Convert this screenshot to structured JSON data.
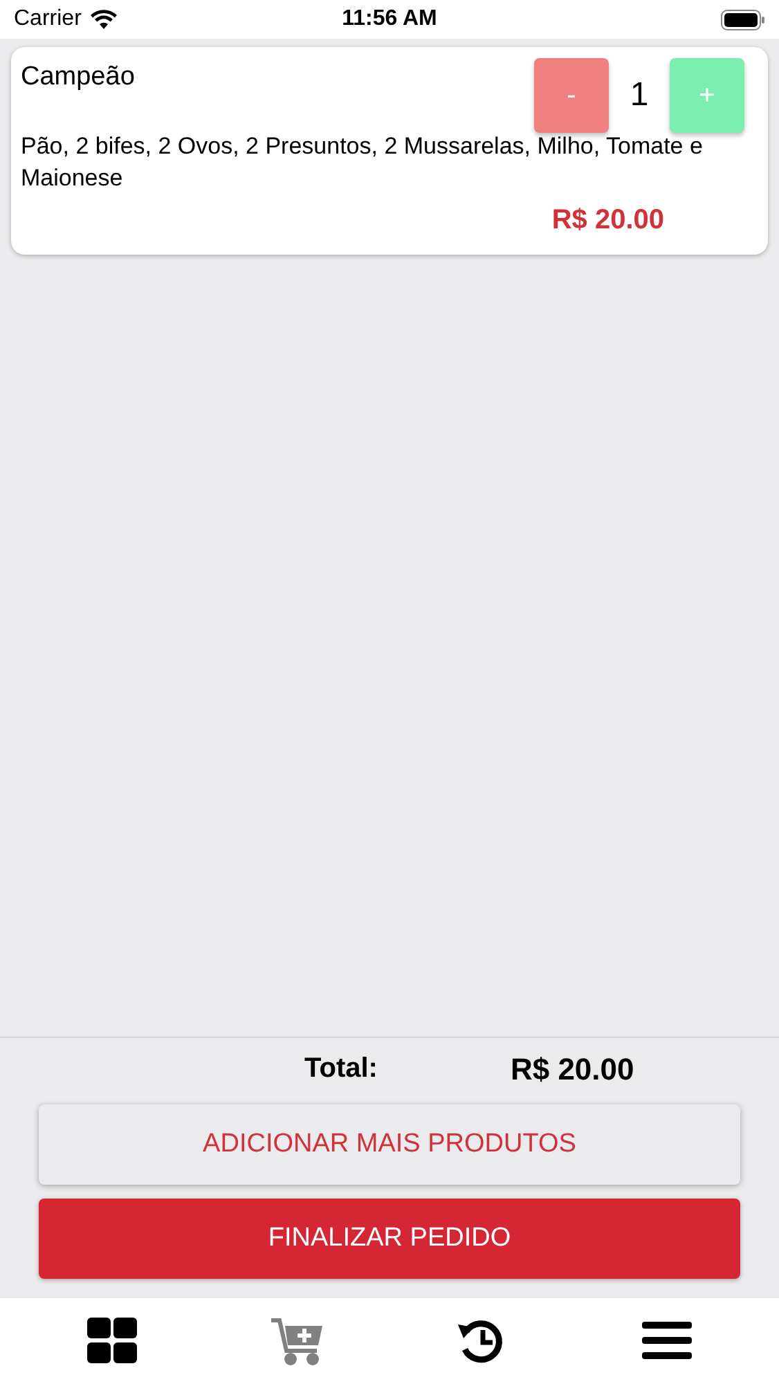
{
  "status_bar": {
    "carrier": "Carrier",
    "time": "11:56 AM"
  },
  "cart_items": [
    {
      "name": "Campeão",
      "description": "Pão, 2 bifes, 2 Ovos, 2 Presuntos, 2 Mussarelas, Milho, Tomate e Maionese",
      "decrement": "-",
      "quantity": "1",
      "increment": "+",
      "price": "R$ 20.00"
    }
  ],
  "summary": {
    "total_label": "Total:",
    "total_value": "R$ 20.00"
  },
  "buttons": [
    {
      "kind": "secondary",
      "label": "ADICIONAR MAIS PRODUTOS"
    },
    {
      "kind": "primary",
      "label": "FINALIZAR PEDIDO"
    }
  ],
  "tab_bar": [
    {
      "kind": "grid",
      "selected": false
    },
    {
      "kind": "cart",
      "selected": true
    },
    {
      "kind": "history",
      "selected": false
    },
    {
      "kind": "menu",
      "selected": false
    }
  ]
}
